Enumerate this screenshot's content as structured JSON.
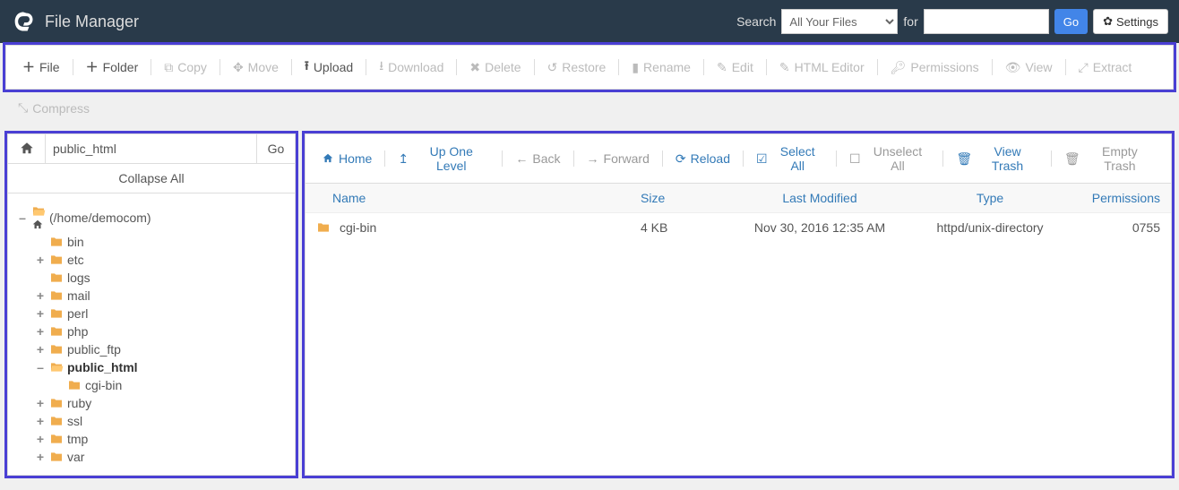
{
  "header": {
    "title": "File Manager",
    "search_label": "Search",
    "search_scope": "All Your Files",
    "for_label": "for",
    "search_value": "",
    "go_label": "Go",
    "settings_label": "Settings"
  },
  "toolbar": {
    "file": "File",
    "folder": "Folder",
    "copy": "Copy",
    "move": "Move",
    "upload": "Upload",
    "download": "Download",
    "delete": "Delete",
    "restore": "Restore",
    "rename": "Rename",
    "edit": "Edit",
    "html_editor": "HTML Editor",
    "permissions": "Permissions",
    "view": "View",
    "extract": "Extract",
    "compress": "Compress"
  },
  "sidebar": {
    "path_value": "public_html",
    "go_label": "Go",
    "collapse_label": "Collapse All",
    "tree": [
      {
        "label": "(/home/democom)",
        "expander": "–",
        "level": 1,
        "icon": "home-open"
      },
      {
        "label": "bin",
        "expander": "",
        "level": 2,
        "icon": "folder"
      },
      {
        "label": "etc",
        "expander": "+",
        "level": 2,
        "icon": "folder"
      },
      {
        "label": "logs",
        "expander": "",
        "level": 2,
        "icon": "folder"
      },
      {
        "label": "mail",
        "expander": "+",
        "level": 2,
        "icon": "folder"
      },
      {
        "label": "perl",
        "expander": "+",
        "level": 2,
        "icon": "folder"
      },
      {
        "label": "php",
        "expander": "+",
        "level": 2,
        "icon": "folder"
      },
      {
        "label": "public_ftp",
        "expander": "+",
        "level": 2,
        "icon": "folder"
      },
      {
        "label": "public_html",
        "expander": "–",
        "level": 2,
        "icon": "open-folder",
        "bold": true
      },
      {
        "label": "cgi-bin",
        "expander": "",
        "level": 3,
        "icon": "folder"
      },
      {
        "label": "ruby",
        "expander": "+",
        "level": 2,
        "icon": "folder"
      },
      {
        "label": "ssl",
        "expander": "+",
        "level": 2,
        "icon": "folder"
      },
      {
        "label": "tmp",
        "expander": "+",
        "level": 2,
        "icon": "folder"
      },
      {
        "label": "var",
        "expander": "+",
        "level": 2,
        "icon": "folder"
      }
    ]
  },
  "navbar": {
    "home": "Home",
    "up": "Up One Level",
    "back": "Back",
    "forward": "Forward",
    "reload": "Reload",
    "select_all": "Select All",
    "unselect_all": "Unselect All",
    "view_trash": "View Trash",
    "empty_trash": "Empty Trash"
  },
  "table": {
    "headers": {
      "name": "Name",
      "size": "Size",
      "modified": "Last Modified",
      "type": "Type",
      "permissions": "Permissions"
    },
    "rows": [
      {
        "name": "cgi-bin",
        "size": "4 KB",
        "modified": "Nov 30, 2016 12:35 AM",
        "type": "httpd/unix-directory",
        "permissions": "0755"
      }
    ]
  }
}
